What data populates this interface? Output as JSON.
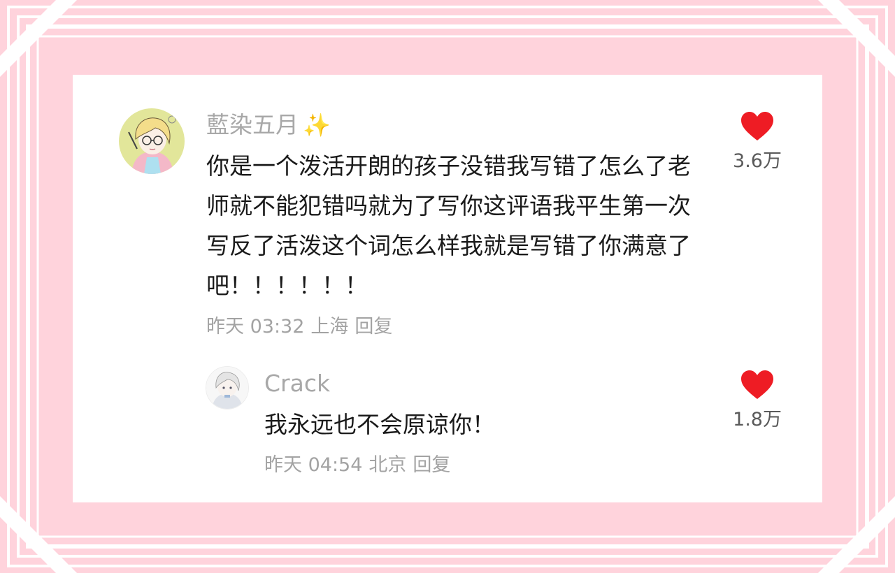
{
  "colors": {
    "frame_pink": "#ffd3dc",
    "frame_white": "#ffffff",
    "heart_red": "#ee1c24",
    "username_gray": "#a8a8a8",
    "text_dark": "#1a1a1a"
  },
  "comments": [
    {
      "avatar_icon": "anime-girl-avatar",
      "username": "藍染五月",
      "username_emoji": "✨",
      "text": "你是一个泼活开朗的孩子没错我写错了怎么了老师就不能犯错吗就为了写你这评语我平生第一次写反了活泼这个词怎么样我就是写错了你满意了吧！！！！！！",
      "time": "昨天 03:32",
      "location": "上海",
      "reply_label": "回复",
      "likes": "3.6万"
    },
    {
      "avatar_icon": "anime-character-avatar",
      "username": "Crack",
      "text": "我永远也不会原谅你！",
      "time": "昨天 04:54",
      "location": "北京",
      "reply_label": "回复",
      "likes": "1.8万"
    }
  ]
}
